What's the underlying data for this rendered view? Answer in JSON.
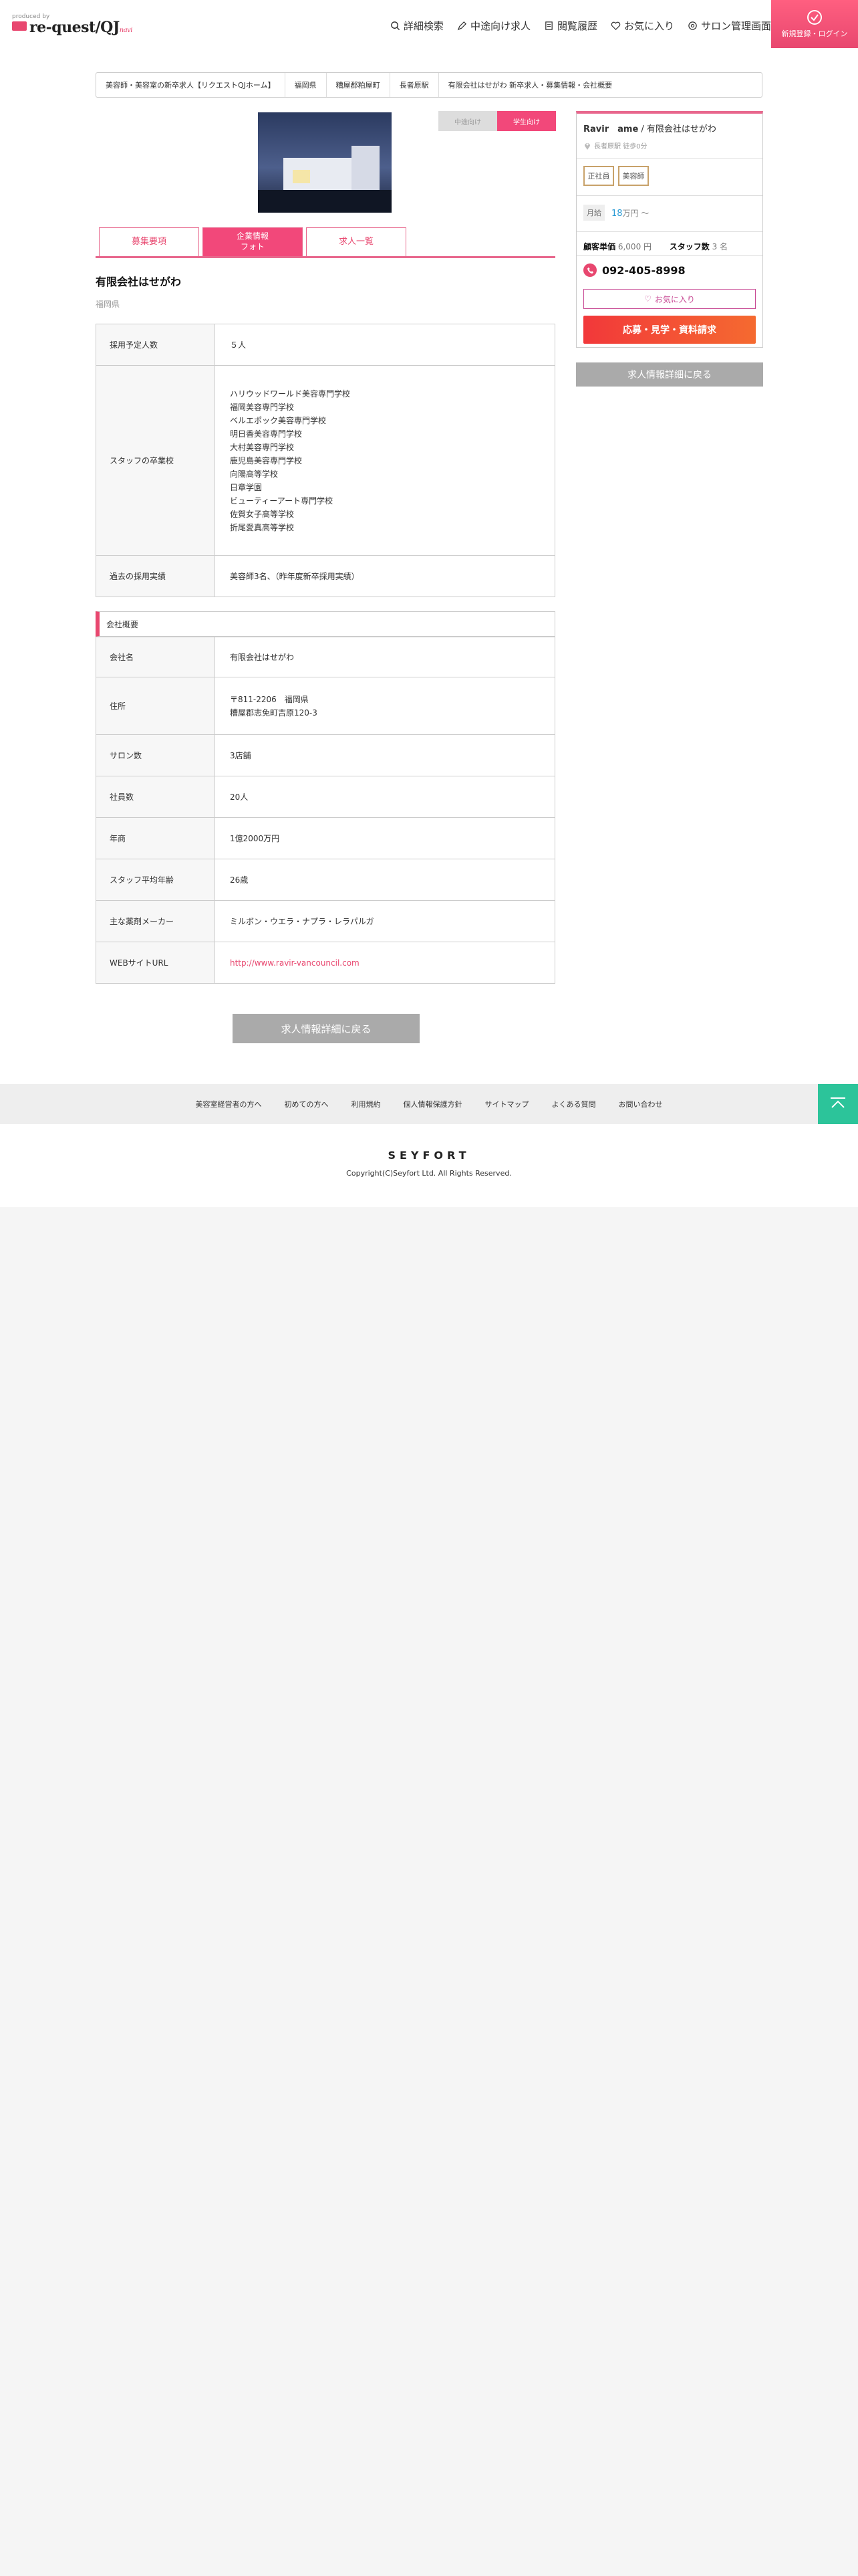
{
  "header": {
    "logo_tag": "produced by",
    "logo_brand": "re-quest/QJ",
    "logo_pro": "navi",
    "nav": [
      {
        "label": "詳細検索",
        "icon": "search-icon"
      },
      {
        "label": "中途向け求人",
        "icon": "pen-icon"
      },
      {
        "label": "閲覧履歴",
        "icon": "history-icon"
      },
      {
        "label": "お気に入り",
        "icon": "heart-icon"
      },
      {
        "label": "サロン管理画面",
        "icon": "settings-icon"
      }
    ],
    "login_label": "新規登録・ログイン"
  },
  "breadcrumb": [
    "美容師・美容室の新卒求人【リクエストQJホーム】",
    "福岡県",
    "糟屋郡粕屋町",
    "長者原駅",
    "有限会社はせがわ 新卒求人・募集情報・会社概要"
  ],
  "toggle": {
    "off": "中途向け",
    "on": "学生向け"
  },
  "tabs": {
    "t1": "募集要項",
    "t2_line1": "企業情報",
    "t2_line2": "フォト",
    "t3": "求人一覧"
  },
  "company": {
    "name": "有限会社はせがわ",
    "pref": "福岡県"
  },
  "recruit": {
    "planned_label": "採用予定人数",
    "planned_value": "５人",
    "schools_label": "スタッフの卒業校",
    "schools": [
      "ハリウッドワールド美容専門学校",
      "福岡美容専門学校",
      "ベルエポック美容専門学校",
      "明日香美容専門学校",
      "大村美容専門学校",
      "鹿児島美容専門学校",
      "向陽高等学校",
      "日章学園",
      "ビューティーアート専門学校",
      "佐賀女子高等学校",
      "折尾愛真高等学校"
    ],
    "past_label": "過去の採用実績",
    "past_value": "美容師3名、（昨年度新卒採用実績）"
  },
  "overview": {
    "heading": "会社概要",
    "rows": {
      "name_label": "会社名",
      "name_value": "有限会社はせがわ",
      "addr_label": "住所",
      "addr_line1": "〒811-2206　福岡県",
      "addr_line2": "糟屋郡志免町吉原120-3",
      "salons_label": "サロン数",
      "salons_value": "3店舗",
      "employees_label": "社員数",
      "employees_value": "20人",
      "revenue_label": "年商",
      "revenue_value": "1億2000万円",
      "age_label": "スタッフ平均年齢",
      "age_value": "26歳",
      "maker_label": "主な薬剤メーカー",
      "maker_value": "ミルボン・ウエラ・ナプラ・レラパルガ",
      "web_label": "WEBサイトURL",
      "web_value": "http://www.ravir-vancouncil.com"
    }
  },
  "back_button": "求人情報詳細に戻る",
  "sidebar": {
    "salon": "Ravir　ame",
    "company": "有限会社はせがわ",
    "location": "長者原駅 徒歩0分",
    "badges": [
      "正社員",
      "美容師"
    ],
    "salary_label": "月給",
    "salary_amount": "18",
    "salary_unit": "万円 〜",
    "unit_price_label": "顧客単価",
    "unit_price": "6,000 円",
    "staff_label": "スタッフ数",
    "staff": "3 名",
    "phone": "092-405-8998",
    "fav": "お気に入り",
    "apply": "応募・見学・資料請求",
    "back": "求人情報詳細に戻る"
  },
  "footer": {
    "links": [
      "美容室経営者の方へ",
      "初めての方へ",
      "利用規約",
      "個人情報保護方針",
      "サイトマップ",
      "よくある質問",
      "お問い合わせ"
    ],
    "brand": "SEYFORT",
    "copyright": "Copyright(C)Seyfort Ltd. All Rights Reserved."
  },
  "colors": {
    "accent": "#e8476f",
    "green": "#2cc49a",
    "gray_button": "#aaaaaa"
  }
}
